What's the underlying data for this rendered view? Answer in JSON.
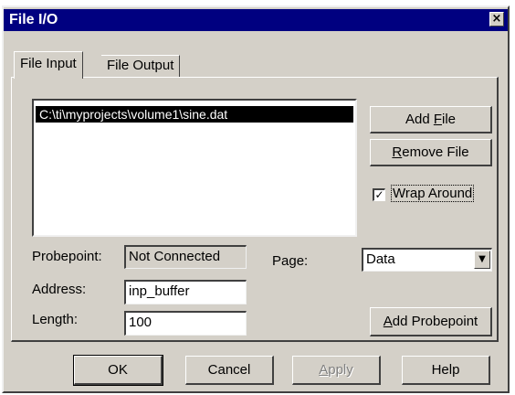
{
  "window": {
    "title": "File I/O",
    "close_icon": "close-icon"
  },
  "tabs": [
    {
      "label": "File Input",
      "active": true
    },
    {
      "label": "File Output",
      "active": false
    }
  ],
  "file_list": {
    "items": [
      "C:\\ti\\myprojects\\volume1\\sine.dat"
    ],
    "selected": 0
  },
  "buttons": {
    "add_file_pre": "Add ",
    "add_file_key": "F",
    "add_file_post": "ile",
    "remove_file_pre": "",
    "remove_file_key": "R",
    "remove_file_post": "emove File",
    "add_probepoint_pre": "",
    "add_probepoint_key": "A",
    "add_probepoint_post": "dd Probepoint"
  },
  "wrap_around": {
    "checked": true,
    "check_glyph": "✓",
    "label": "Wrap Around"
  },
  "fields": {
    "probepoint_label": "Probepoint:",
    "probepoint_value": "Not Connected",
    "page_label": "Page:",
    "page_value": "Data",
    "address_label": "Address:",
    "address_value": "inp_buffer",
    "length_label": "Length:",
    "length_value": "100"
  },
  "footer": {
    "ok": "OK",
    "cancel": "Cancel",
    "apply_key": "A",
    "apply_post": "pply",
    "help": "Help"
  },
  "colors": {
    "face": "#d4d0c8",
    "titlebar": "#000080",
    "selection": "#000000"
  }
}
